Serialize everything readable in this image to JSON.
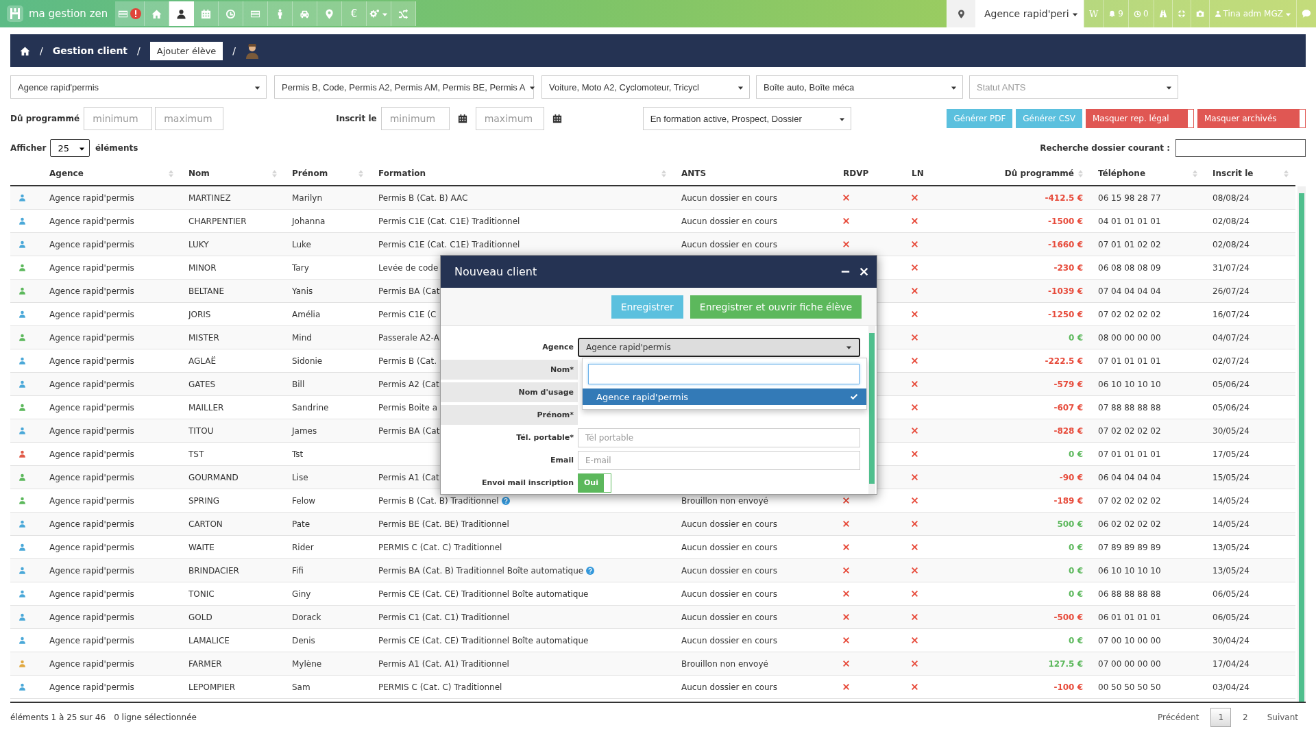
{
  "topbar": {
    "logo_text": "ma gestion zen",
    "nav": [
      {
        "selected": false,
        "alert": true
      },
      {
        "selected": false
      },
      {
        "selected": true
      },
      {
        "selected": false
      },
      {
        "selected": false
      },
      {
        "selected": false
      },
      {
        "selected": false
      },
      {
        "selected": false
      },
      {
        "selected": false
      },
      {
        "selected": false,
        "label": "€"
      },
      {
        "selected": false,
        "menu": true
      },
      {
        "selected": false
      }
    ],
    "agency": "Agence rapid'peri",
    "letter": "W",
    "notifications": "9",
    "timers": "0",
    "user": "Tina adm MGZ"
  },
  "breadcrumb": {
    "title": "Gestion client",
    "button": "Ajouter élève",
    "separators": [
      "/",
      "/",
      "/"
    ]
  },
  "filters": {
    "agency": "Agence rapid'permis",
    "formations": "Permis B, Code, Permis A2, Permis AM, Permis BE, Permis A",
    "vehicles": "Voiture, Moto A2, Cyclomoteur, Tricycl",
    "gearbox": "Boîte auto, Boîte méca",
    "ants_placeholder": "Statut ANTS",
    "due_label": "Dû programmé",
    "due_min_placeholder": "minimum",
    "due_max_placeholder": "maximum",
    "date_label": "Inscrit le",
    "date_min_placeholder": "minimum",
    "date_max_placeholder": "maximum",
    "statuses": "En formation active, Prospect, Dossier",
    "buttons": [
      {
        "label": "Générer PDF",
        "kind": "info"
      },
      {
        "label": "Générer CSV",
        "kind": "info"
      },
      {
        "label": "Masquer rep. légal",
        "kind": "toggle",
        "on": false
      },
      {
        "label": "Masquer archivés",
        "kind": "toggle",
        "on": false
      }
    ]
  },
  "length": {
    "before": "Afficher",
    "value": "25",
    "after": "éléments"
  },
  "search": {
    "label": "Recherche dossier courant :"
  },
  "table": {
    "columns": [
      {
        "label": "Agence",
        "sortable": true
      },
      {
        "label": "Nom",
        "sortable": true
      },
      {
        "label": "Prénom",
        "sortable": true
      },
      {
        "label": "Formation",
        "sortable": true
      },
      {
        "label": "ANTS",
        "sortable": false
      },
      {
        "label": "RDVP",
        "sortable": false
      },
      {
        "label": "LN",
        "sortable": false
      },
      {
        "label": "Dû programmé",
        "sortable": true
      },
      {
        "label": "Téléphone",
        "sortable": true
      },
      {
        "label": "Inscrit le",
        "sortable": true
      }
    ],
    "rows": [
      {
        "color": "#4aa8d8",
        "agence": "Agence rapid'permis",
        "nom": "MARTINEZ",
        "prenom": "Marilyn",
        "formation": "Permis B (Cat. B) AAC",
        "ants": "Aucun dossier en cours",
        "rdvp": false,
        "ln": false,
        "due": "-412.5 €",
        "overdue": true,
        "tel": "06 15 98 28 77",
        "date": "08/08/24"
      },
      {
        "color": "#4aa8d8",
        "agence": "Agence rapid'permis",
        "nom": "CHARPENTIER",
        "prenom": "Johanna",
        "formation": "Permis C1E (Cat. C1E) Traditionnel",
        "ants": "Aucun dossier en cours",
        "rdvp": false,
        "ln": false,
        "due": "-1500 €",
        "overdue": true,
        "tel": "04 01 01 01 01",
        "date": "02/08/24"
      },
      {
        "color": "#4aa8d8",
        "agence": "Agence rapid'permis",
        "nom": "LUKY",
        "prenom": "Luke",
        "formation": "Permis C1E (Cat. C1E) Traditionnel",
        "ants": "Aucun dossier en cours",
        "rdvp": false,
        "ln": false,
        "due": "-1660 €",
        "overdue": true,
        "tel": "07 01 01 02 02",
        "date": "02/08/24"
      },
      {
        "color": "#5cb85c",
        "agence": "Agence rapid'permis",
        "nom": "MINOR",
        "prenom": "Tary",
        "formation": "Levée de code",
        "ln": false,
        "due": "-230 €",
        "overdue": true,
        "tel": "06 08 08 08 09",
        "date": "31/07/24"
      },
      {
        "color": "#5cb85c",
        "agence": "Agence rapid'permis",
        "nom": "BELTANE",
        "prenom": "Yanis",
        "formation": "Permis BA (Cat",
        "ln": false,
        "due": "-1039 €",
        "overdue": true,
        "tel": "07 04 04 04 04",
        "date": "26/07/24"
      },
      {
        "color": "#4aa8d8",
        "agence": "Agence rapid'permis",
        "nom": "JORIS",
        "prenom": "Amélia",
        "formation": "Permis C1E (C",
        "ln": false,
        "due": "-1250 €",
        "overdue": true,
        "tel": "07 02 02 02 02",
        "date": "16/07/24"
      },
      {
        "color": "#5cb85c",
        "agence": "Agence rapid'permis",
        "nom": "MISTER",
        "prenom": "Mind",
        "formation": "Passerale A2-A",
        "ln": false,
        "due": "0 €",
        "overdue": false,
        "tel": "08 00 00 00 00",
        "date": "04/07/24"
      },
      {
        "color": "#4aa8d8",
        "agence": "Agence rapid'permis",
        "nom": "AGLAË",
        "prenom": "Sidonie",
        "formation": "Permis B (Cat.",
        "ln": false,
        "due": "-222.5 €",
        "overdue": true,
        "tel": "07 01 01 01 01",
        "date": "02/07/24"
      },
      {
        "color": "#4aa8d8",
        "agence": "Agence rapid'permis",
        "nom": "GATES",
        "prenom": "Bill",
        "formation": "Permis A2 (Cat",
        "ln": false,
        "due": "-579 €",
        "overdue": true,
        "tel": "06 10 10 10 10",
        "date": "05/06/24"
      },
      {
        "color": "#5cb85c",
        "agence": "Agence rapid'permis",
        "nom": "MAILLER",
        "prenom": "Sandrine",
        "formation": "Permis Boite a",
        "ln": false,
        "due": "-607 €",
        "overdue": true,
        "tel": "07 88 88 88 88",
        "date": "05/06/24"
      },
      {
        "color": "#4aa8d8",
        "agence": "Agence rapid'permis",
        "nom": "TITOU",
        "prenom": "James",
        "formation": "Permis BA (Cat",
        "ln": false,
        "due": "-828 €",
        "overdue": true,
        "tel": "07 02 02 02 02",
        "date": "30/05/24"
      },
      {
        "color": "#e05a47",
        "agence": "Agence rapid'permis",
        "nom": "TST",
        "prenom": "Tst",
        "ln": false,
        "due": "0 €",
        "overdue": false,
        "tel": "07 01 01 01 01",
        "date": "17/05/24"
      },
      {
        "color": "#5cb85c",
        "agence": "Agence rapid'permis",
        "nom": "GOURMAND",
        "prenom": "Lise",
        "formation": "Permis A1 (Cat",
        "ln": false,
        "due": "-90 €",
        "overdue": true,
        "tel": "06 04 04 04 04",
        "date": "15/05/24"
      },
      {
        "color": "#5cb85c",
        "agence": "Agence rapid'permis",
        "nom": "SPRING",
        "prenom": "Felow",
        "formation": "Permis B (Cat. B) Traditionnel",
        "help": true,
        "ants": "Brouillon non envoyé",
        "rdvp": false,
        "ln": false,
        "due": "-189 €",
        "overdue": true,
        "tel": "07 02 02 02 02",
        "date": "14/05/24"
      },
      {
        "color": "#4aa8d8",
        "agence": "Agence rapid'permis",
        "nom": "CARTON",
        "prenom": "Pate",
        "formation": "Permis BE (Cat. BE) Traditionnel",
        "ants": "Aucun dossier en cours",
        "rdvp": false,
        "ln": false,
        "due": "500 €",
        "overdue": false,
        "tel": "06 02 02 02 02",
        "date": "14/05/24"
      },
      {
        "color": "#4aa8d8",
        "agence": "Agence rapid'permis",
        "nom": "WAITE",
        "prenom": "Rider",
        "formation": "PERMIS C (Cat. C) Traditionnel",
        "ants": "Aucun dossier en cours",
        "rdvp": false,
        "ln": false,
        "due": "0 €",
        "overdue": false,
        "tel": "07 89 89 89 89",
        "date": "13/05/24"
      },
      {
        "color": "#4aa8d8",
        "agence": "Agence rapid'permis",
        "nom": "BRINDACIER",
        "prenom": "Fifi",
        "formation": "Permis BA (Cat. B) Traditionnel Boîte automatique",
        "help": true,
        "ants": "Aucun dossier en cours",
        "rdvp": false,
        "ln": false,
        "due": "0 €",
        "overdue": false,
        "tel": "06 10 10 10 10",
        "date": "13/05/24"
      },
      {
        "color": "#4aa8d8",
        "agence": "Agence rapid'permis",
        "nom": "TONIC",
        "prenom": "Giny",
        "formation": "Permis CE (Cat. CE) Traditionnel Boîte automatique",
        "ants": "Aucun dossier en cours",
        "rdvp": false,
        "ln": false,
        "due": "0 €",
        "overdue": false,
        "tel": "06 88 88 88 88",
        "date": "06/05/24"
      },
      {
        "color": "#4aa8d8",
        "agence": "Agence rapid'permis",
        "nom": "GOLD",
        "prenom": "Dorack",
        "formation": "Permis C1 (Cat. C1) Traditionnel",
        "ants": "Aucun dossier en cours",
        "rdvp": false,
        "ln": false,
        "due": "-500 €",
        "overdue": true,
        "tel": "06 01 01 01 01",
        "date": "06/05/24"
      },
      {
        "color": "#4aa8d8",
        "agence": "Agence rapid'permis",
        "nom": "LAMALICE",
        "prenom": "Denis",
        "formation": "Permis CE (Cat. CE) Traditionnel Boîte automatique",
        "ants": "Aucun dossier en cours",
        "rdvp": false,
        "ln": false,
        "due": "0 €",
        "overdue": false,
        "tel": "07 00 10 00 00",
        "date": "30/04/24"
      },
      {
        "color": "#e0a840",
        "agence": "Agence rapid'permis",
        "nom": "FARMER",
        "prenom": "Mylène",
        "formation": "Permis A1 (Cat. A1) Traditionnel",
        "ants": "Brouillon non envoyé",
        "rdvp": false,
        "ln": false,
        "due": "127.5 €",
        "overdue": false,
        "tel": "07 00 00 00 00",
        "date": "17/04/24"
      },
      {
        "color": "#4aa8d8",
        "agence": "Agence rapid'permis",
        "nom": "LEPOMPIER",
        "prenom": "Sam",
        "formation": "PERMIS C (Cat. C) Traditionnel",
        "ants": "Aucun dossier en cours",
        "rdvp": false,
        "ln": false,
        "due": "-100 €",
        "overdue": true,
        "tel": "00 50 50 50 50",
        "date": "03/04/24"
      }
    ]
  },
  "footer": {
    "info": "éléments 1 à 25 sur 46",
    "selection": "0 ligne sélectionnée",
    "previous": "Précédent",
    "pages": [
      {
        "label": "1",
        "selected": true
      },
      {
        "label": "2",
        "selected": false
      }
    ],
    "next": "Suivant"
  },
  "modal": {
    "title": "Nouveau client",
    "buttons": [
      {
        "label": "Enregistrer",
        "kind": "info"
      },
      {
        "label": "Enregistrer et ouvrir fiche élève",
        "kind": "success"
      }
    ],
    "fields": [
      {
        "kind": "select",
        "label": "Agence",
        "value": "Agence rapid'permis",
        "expanded": true,
        "options": [
          {
            "label": "Agence rapid'permis",
            "selected": true
          }
        ]
      },
      {
        "kind": "hidden",
        "label": "Nom*"
      },
      {
        "kind": "hidden",
        "label": "Nom d'usage"
      },
      {
        "kind": "hidden",
        "label": "Prénom*"
      },
      {
        "kind": "text",
        "label": "Tél. portable*",
        "placeholder": "Tél portable"
      },
      {
        "kind": "text",
        "label": "Email",
        "placeholder": "E-mail"
      },
      {
        "kind": "toggle",
        "label": "Envoi mail inscription",
        "value": "Oui",
        "on": true
      }
    ]
  }
}
